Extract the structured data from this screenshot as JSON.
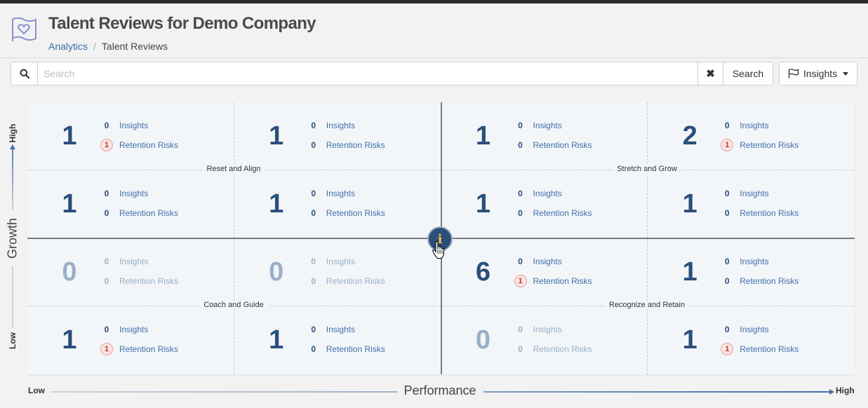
{
  "header": {
    "title": "Talent Reviews for Demo Company",
    "breadcrumbs": [
      {
        "label": "Analytics",
        "link": true
      },
      {
        "label": "Talent Reviews",
        "link": false
      }
    ],
    "separator": "/"
  },
  "search": {
    "placeholder": "Search",
    "value": "",
    "clear_glyph": "✖",
    "button_label": "Search"
  },
  "insights_dropdown": {
    "label": "Insights"
  },
  "quadrants": {
    "top_left": "Reset and Align",
    "top_right": "Stretch and Grow",
    "bottom_left": "Coach and Guide",
    "bottom_right": "Recognize and Retain"
  },
  "labels": {
    "insights": "Insights",
    "retention": "Retention Risks"
  },
  "grid_cells": [
    [
      {
        "count": "1",
        "insights": "0",
        "risks": "1"
      },
      {
        "count": "1",
        "insights": "0",
        "risks": "0"
      },
      {
        "count": "1",
        "insights": "0",
        "risks": "0"
      },
      {
        "count": "2",
        "insights": "0",
        "risks": "1"
      }
    ],
    [
      {
        "count": "1",
        "insights": "0",
        "risks": "0"
      },
      {
        "count": "1",
        "insights": "0",
        "risks": "0"
      },
      {
        "count": "1",
        "insights": "0",
        "risks": "0"
      },
      {
        "count": "1",
        "insights": "0",
        "risks": "0"
      }
    ],
    [
      {
        "count": "0",
        "insights": "0",
        "risks": "0"
      },
      {
        "count": "0",
        "insights": "0",
        "risks": "0"
      },
      {
        "count": "6",
        "insights": "0",
        "risks": "1"
      },
      {
        "count": "1",
        "insights": "0",
        "risks": "0"
      }
    ],
    [
      {
        "count": "1",
        "insights": "0",
        "risks": "1"
      },
      {
        "count": "1",
        "insights": "0",
        "risks": "0"
      },
      {
        "count": "0",
        "insights": "0",
        "risks": "0"
      },
      {
        "count": "1",
        "insights": "0",
        "risks": "1"
      }
    ]
  ],
  "axes": {
    "y_title": "Growth",
    "y_high": "High",
    "y_low": "Low",
    "x_title": "Performance",
    "x_low": "Low",
    "x_high": "High"
  },
  "info_glyph": "i",
  "colors": {
    "accent": "#2b4f7a",
    "link": "#3f6fa8",
    "risk_badge": "#fbe3e3",
    "muted": "#9aafc7"
  },
  "icons": [
    "talent-review-logo-icon",
    "search-icon",
    "clear-icon",
    "flag-icon",
    "caret-down-icon",
    "info-icon",
    "hand-cursor-icon"
  ]
}
